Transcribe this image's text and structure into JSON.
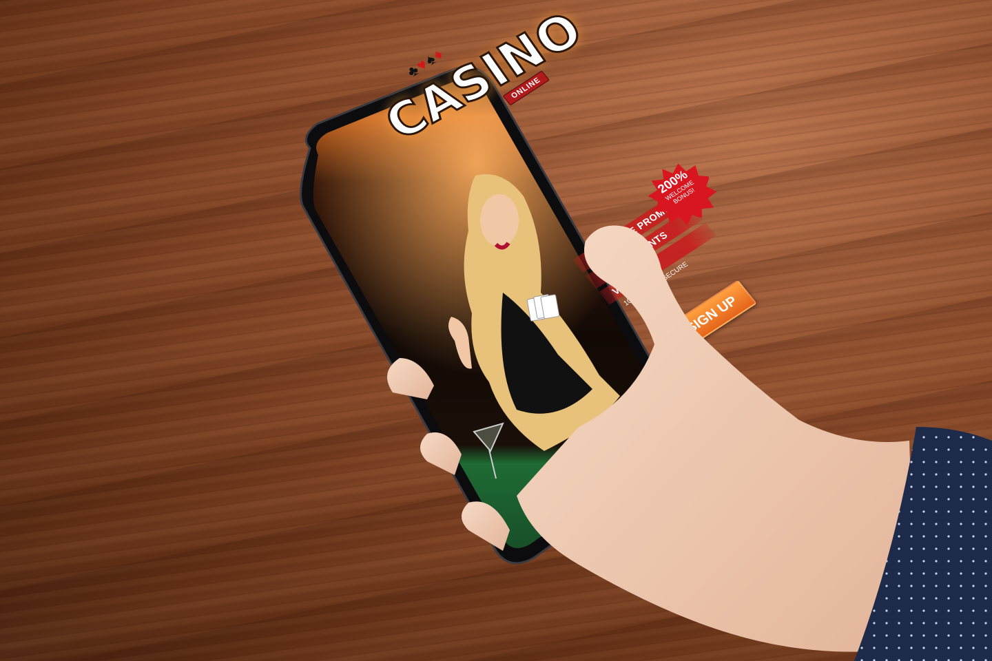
{
  "screen": {
    "title": "CASINO",
    "subtitle": "ONLINE",
    "suit_icons": [
      "♣",
      "♥",
      "♠",
      "♦"
    ],
    "menu_items": [
      "EXCLUSIVE PROMOS",
      "TOURNAMENTS",
      "VIP CLUB"
    ],
    "safe_text": "100% SAFE & SECURE",
    "bonus": {
      "percent": "200%",
      "line1": "WELCOME",
      "line2": "BONUS!"
    },
    "signup_label": "SIGN UP"
  },
  "colors": {
    "wood": "#7a3d1e",
    "accent_orange": "#e5641a",
    "accent_red": "#c81e1e",
    "felt_green": "#1f6b34",
    "sleeve": "#1e2a4a"
  }
}
